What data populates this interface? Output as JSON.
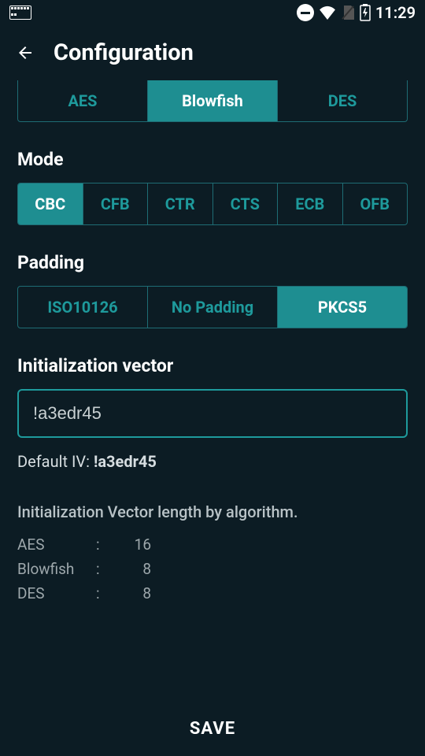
{
  "status": {
    "time": "11:29"
  },
  "header": {
    "title": "Configuration"
  },
  "algorithm": {
    "options": [
      "AES",
      "Blowfish",
      "DES"
    ],
    "selected": "Blowfish"
  },
  "mode": {
    "label": "Mode",
    "options": [
      "CBC",
      "CFB",
      "CTR",
      "CTS",
      "ECB",
      "OFB"
    ],
    "selected": "CBC"
  },
  "padding": {
    "label": "Padding",
    "options": [
      "ISO10126",
      "No Padding",
      "PKCS5"
    ],
    "selected": "PKCS5"
  },
  "iv": {
    "label": "Initialization vector",
    "value": "!a3edr45",
    "default_prefix": "Default IV: ",
    "default_value": "!a3edr45"
  },
  "iv_info": {
    "title": "Initialization Vector length by algorithm.",
    "rows": [
      {
        "algo": "AES",
        "sep": ":",
        "len": "16"
      },
      {
        "algo": "Blowfish",
        "sep": ":",
        "len": "8"
      },
      {
        "algo": "DES",
        "sep": ":",
        "len": "8"
      }
    ]
  },
  "save": {
    "label": "SAVE"
  }
}
